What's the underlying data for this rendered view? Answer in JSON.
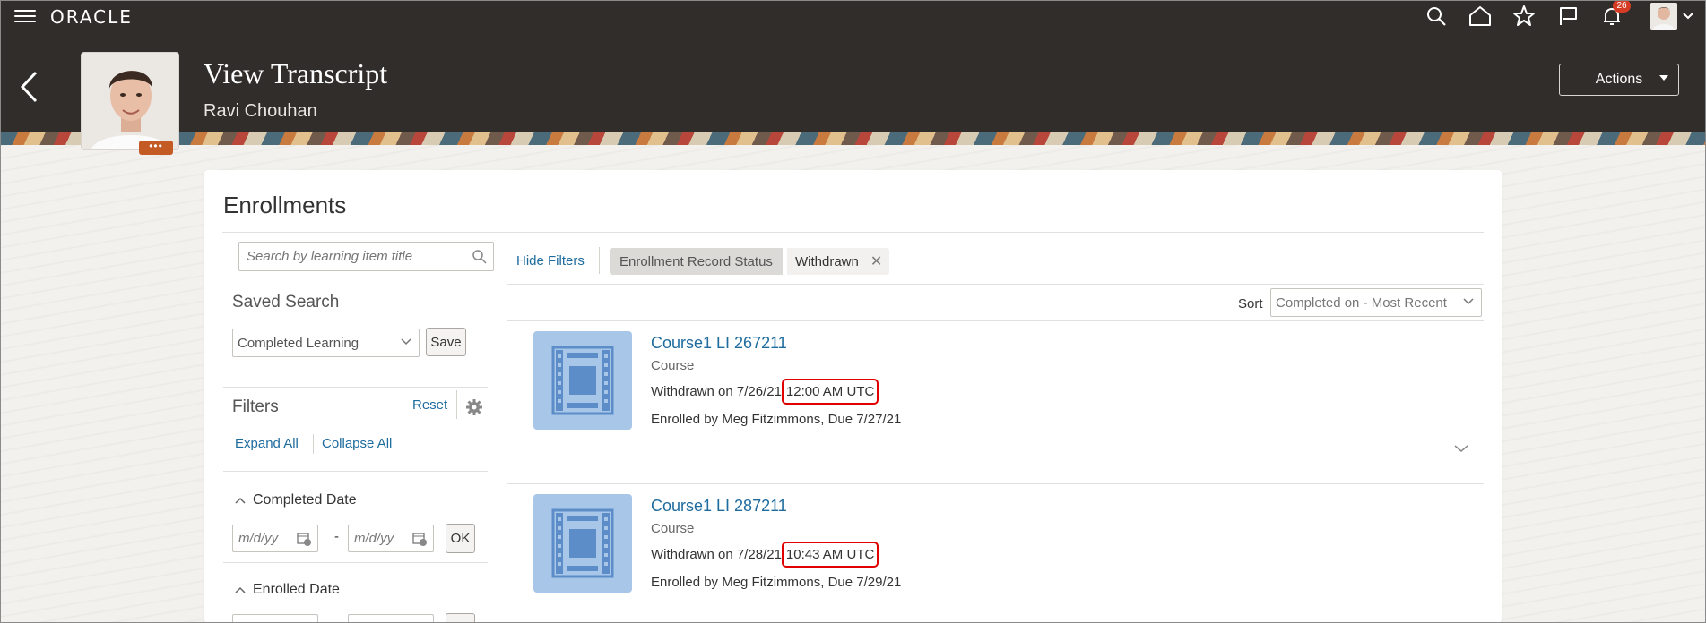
{
  "topbar": {
    "logo": "ORACLE",
    "notifications_count": "26"
  },
  "header": {
    "title": "View Transcript",
    "subtitle": "Ravi Chouhan",
    "actions_label": "Actions",
    "photo_menu": "•••"
  },
  "enrollments": {
    "title": "Enrollments",
    "search_placeholder": "Search by learning item title",
    "saved_search_label": "Saved Search",
    "saved_search_value": "Completed Learning",
    "save_label": "Save",
    "filters_label": "Filters",
    "reset_label": "Reset",
    "expand_all": "Expand All",
    "collapse_all": "Collapse All",
    "hide_filters": "Hide Filters",
    "facets": {
      "completed_date": "Completed Date",
      "enrolled_date": "Enrolled Date",
      "date_placeholder": "m/d/yy",
      "range_sep": "-",
      "ok_label": "OK"
    },
    "active_filter": {
      "label": "Enrollment Record Status",
      "value": "Withdrawn",
      "remove": "✕"
    },
    "sort_label": "Sort",
    "sort_value": "Completed on - Most Recent"
  },
  "results": [
    {
      "title": "Course1 LI 267211",
      "type": "Course",
      "status_prefix": "Withdrawn on 7/26/21",
      "status_time": "12:00 AM UTC",
      "enrolled": "Enrolled by Meg Fitzimmons, Due 7/27/21"
    },
    {
      "title": "Course1 LI 287211",
      "type": "Course",
      "status_prefix": "Withdrawn on 7/28/21",
      "status_time": "10:43 AM UTC",
      "enrolled": "Enrolled by Meg Fitzimmons, Due 7/29/21"
    }
  ],
  "colors": {
    "header_bg": "#312d2a",
    "link": "#1e6b9e",
    "highlight": "#e00000",
    "badge": "#d63b25",
    "thumb": "#a8c6e8"
  }
}
